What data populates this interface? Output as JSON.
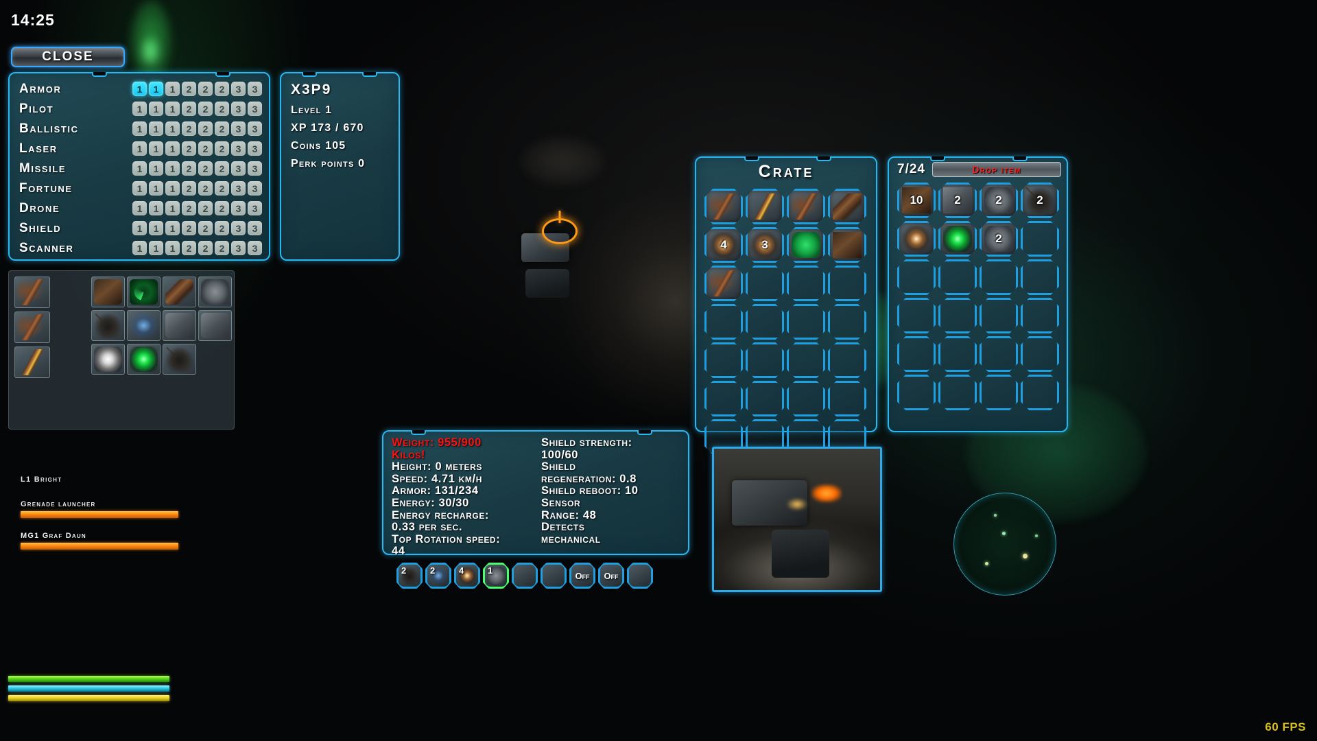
{
  "hud": {
    "clock": "14:25",
    "fps": "60 FPS",
    "close_label": "Close"
  },
  "perks": {
    "rows": [
      {
        "label": "Armor",
        "cells": [
          "1",
          "1",
          "1",
          "2",
          "2",
          "2",
          "3",
          "3"
        ],
        "unlocked": 2
      },
      {
        "label": "Pilot",
        "cells": [
          "1",
          "1",
          "1",
          "2",
          "2",
          "2",
          "3",
          "3"
        ],
        "unlocked": 0
      },
      {
        "label": "Ballistic",
        "cells": [
          "1",
          "1",
          "1",
          "2",
          "2",
          "2",
          "3",
          "3"
        ],
        "unlocked": 0
      },
      {
        "label": "Laser",
        "cells": [
          "1",
          "1",
          "1",
          "2",
          "2",
          "2",
          "3",
          "3"
        ],
        "unlocked": 0
      },
      {
        "label": "Missile",
        "cells": [
          "1",
          "1",
          "1",
          "2",
          "2",
          "2",
          "3",
          "3"
        ],
        "unlocked": 0
      },
      {
        "label": "Fortune",
        "cells": [
          "1",
          "1",
          "1",
          "2",
          "2",
          "2",
          "3",
          "3"
        ],
        "unlocked": 0
      },
      {
        "label": "Drone",
        "cells": [
          "1",
          "1",
          "1",
          "2",
          "2",
          "2",
          "3",
          "3"
        ],
        "unlocked": 0
      },
      {
        "label": "Shield",
        "cells": [
          "1",
          "1",
          "1",
          "2",
          "2",
          "2",
          "3",
          "3"
        ],
        "unlocked": 0
      },
      {
        "label": "Scanner",
        "cells": [
          "1",
          "1",
          "1",
          "2",
          "2",
          "2",
          "3",
          "3"
        ],
        "unlocked": 0
      }
    ]
  },
  "player": {
    "name": "X3P9",
    "level": "Level 1",
    "xp": "XP 173 / 670",
    "coins": "Coins 105",
    "perk_points": "Perk points 0"
  },
  "crate": {
    "title": "Crate",
    "slots": [
      {
        "icon": "minigun-icon",
        "art": "art-gun",
        "count": ""
      },
      {
        "icon": "rifle-icon",
        "art": "art-gun2",
        "count": ""
      },
      {
        "icon": "cannon-icon",
        "art": "art-gun",
        "count": ""
      },
      {
        "icon": "armor-plate-icon",
        "art": "art-pack",
        "count": ""
      },
      {
        "icon": "explosive-icon",
        "art": "art-spark",
        "count": "4"
      },
      {
        "icon": "explosive-icon",
        "art": "art-spark",
        "count": "3"
      },
      {
        "icon": "green-module-icon",
        "art": "art-green-card",
        "count": ""
      },
      {
        "icon": "crate-box-icon",
        "art": "art-dark-brown",
        "count": ""
      },
      {
        "icon": "minigun-icon",
        "art": "art-gun",
        "count": ""
      },
      {
        "icon": "empty-slot-icon",
        "art": "",
        "count": ""
      },
      {
        "icon": "empty-slot-icon",
        "art": "",
        "count": ""
      },
      {
        "icon": "empty-slot-icon",
        "art": "",
        "count": ""
      },
      {
        "icon": "empty-slot-icon",
        "art": "",
        "count": ""
      },
      {
        "icon": "empty-slot-icon",
        "art": "",
        "count": ""
      },
      {
        "icon": "empty-slot-icon",
        "art": "",
        "count": ""
      },
      {
        "icon": "empty-slot-icon",
        "art": "",
        "count": ""
      },
      {
        "icon": "empty-slot-icon",
        "art": "",
        "count": ""
      },
      {
        "icon": "empty-slot-icon",
        "art": "",
        "count": ""
      },
      {
        "icon": "empty-slot-icon",
        "art": "",
        "count": ""
      },
      {
        "icon": "empty-slot-icon",
        "art": "",
        "count": ""
      },
      {
        "icon": "empty-slot-icon",
        "art": "",
        "count": ""
      },
      {
        "icon": "empty-slot-icon",
        "art": "",
        "count": ""
      },
      {
        "icon": "empty-slot-icon",
        "art": "",
        "count": ""
      },
      {
        "icon": "empty-slot-icon",
        "art": "",
        "count": ""
      },
      {
        "icon": "empty-slot-icon",
        "art": "",
        "count": ""
      },
      {
        "icon": "empty-slot-icon",
        "art": "",
        "count": ""
      },
      {
        "icon": "empty-slot-icon",
        "art": "",
        "count": ""
      },
      {
        "icon": "empty-slot-icon",
        "art": "",
        "count": ""
      }
    ]
  },
  "inventory": {
    "count_label": "7/24",
    "drop_label": "Drop item",
    "slots": [
      {
        "icon": "ammo-box-icon",
        "art": "art-dark-brown",
        "count": "10"
      },
      {
        "icon": "battery-icon",
        "art": "art-grey-metal",
        "count": "2"
      },
      {
        "icon": "gear-icon",
        "art": "art-gear",
        "count": "2"
      },
      {
        "icon": "shield-icon",
        "art": "art-bug",
        "count": "2"
      },
      {
        "icon": "explosive-icon",
        "art": "art-spark",
        "count": ""
      },
      {
        "icon": "green-orb-icon",
        "art": "art-green-orb",
        "count": ""
      },
      {
        "icon": "gear-icon",
        "art": "art-gear",
        "count": "2"
      },
      {
        "icon": "empty-slot-icon",
        "art": "",
        "count": ""
      },
      {
        "icon": "empty-slot-icon",
        "art": "",
        "count": ""
      },
      {
        "icon": "empty-slot-icon",
        "art": "",
        "count": ""
      },
      {
        "icon": "empty-slot-icon",
        "art": "",
        "count": ""
      },
      {
        "icon": "empty-slot-icon",
        "art": "",
        "count": ""
      },
      {
        "icon": "empty-slot-icon",
        "art": "",
        "count": ""
      },
      {
        "icon": "empty-slot-icon",
        "art": "",
        "count": ""
      },
      {
        "icon": "empty-slot-icon",
        "art": "",
        "count": ""
      },
      {
        "icon": "empty-slot-icon",
        "art": "",
        "count": ""
      },
      {
        "icon": "empty-slot-icon",
        "art": "",
        "count": ""
      },
      {
        "icon": "empty-slot-icon",
        "art": "",
        "count": ""
      },
      {
        "icon": "empty-slot-icon",
        "art": "",
        "count": ""
      },
      {
        "icon": "empty-slot-icon",
        "art": "",
        "count": ""
      },
      {
        "icon": "empty-slot-icon",
        "art": "",
        "count": ""
      },
      {
        "icon": "empty-slot-icon",
        "art": "",
        "count": ""
      },
      {
        "icon": "empty-slot-icon",
        "art": "",
        "count": ""
      },
      {
        "icon": "empty-slot-icon",
        "art": "",
        "count": ""
      }
    ]
  },
  "equipment": {
    "left_slots": [
      {
        "icon": "minigun-icon",
        "art": "art-gun"
      },
      {
        "icon": "barrel-icon",
        "art": "art-gun"
      },
      {
        "icon": "rifle-icon",
        "art": "art-gun2"
      }
    ],
    "grid_slots": [
      {
        "icon": "engine-icon",
        "art": "art-dark-brown"
      },
      {
        "icon": "radar-icon",
        "art": "art-radar"
      },
      {
        "icon": "armor-plate-icon",
        "art": "art-pack"
      },
      {
        "icon": "gear-icon",
        "art": "art-gear"
      },
      {
        "icon": "thruster-icon",
        "art": "art-bug"
      },
      {
        "icon": "energy-icon",
        "art": "art-blue-bolt"
      },
      {
        "icon": "metal-part-icon",
        "art": "art-grey-metal"
      },
      {
        "icon": "module-icon",
        "art": "art-grey-metal"
      },
      {
        "icon": "white-orb-icon",
        "art": "art-white-orb"
      },
      {
        "icon": "green-orb-icon",
        "art": "art-green-orb"
      },
      {
        "icon": "drone-icon",
        "art": "art-bug"
      }
    ]
  },
  "stats": {
    "left": [
      {
        "text": "Weight: 955/900",
        "warn": true
      },
      {
        "text": "Kilos!",
        "warn": true
      },
      {
        "text": "Height: 0 meters",
        "warn": false
      },
      {
        "text": "Speed: 4.71 km/h",
        "warn": false
      },
      {
        "text": "Armor: 131/234",
        "warn": false
      },
      {
        "text": "Energy: 30/30",
        "warn": false
      },
      {
        "text": "Energy recharge:",
        "warn": false
      },
      {
        "text": "0.33 per sec.",
        "warn": false
      },
      {
        "text": "Top Rotation speed:",
        "warn": false
      },
      {
        "text": "44",
        "warn": false
      }
    ],
    "right": [
      {
        "text": "Shield strength:",
        "warn": false
      },
      {
        "text": "100/60",
        "warn": false
      },
      {
        "text": "Shield",
        "warn": false
      },
      {
        "text": "regeneration: 0.8",
        "warn": false
      },
      {
        "text": "Shield reboot: 10",
        "warn": false
      },
      {
        "text": "Sensor",
        "warn": false
      },
      {
        "text": "Range: 48",
        "warn": false
      },
      {
        "text": "Detects",
        "warn": false
      },
      {
        "text": "mechanical",
        "warn": false
      }
    ]
  },
  "hotbar": [
    {
      "num": "2",
      "icon": "shield-icon",
      "art": "art-bug",
      "active": false,
      "off": ""
    },
    {
      "num": "2",
      "icon": "energy-icon",
      "art": "art-blue-bolt",
      "active": false,
      "off": ""
    },
    {
      "num": "4",
      "icon": "explosive-icon",
      "art": "art-spark",
      "active": false,
      "off": ""
    },
    {
      "num": "1",
      "icon": "gear-icon",
      "art": "art-gear",
      "active": true,
      "off": ""
    },
    {
      "num": "",
      "icon": "empty-slot-icon",
      "art": "",
      "active": false,
      "off": ""
    },
    {
      "num": "",
      "icon": "empty-slot-icon",
      "art": "",
      "active": false,
      "off": ""
    },
    {
      "num": "",
      "icon": "toggle-icon",
      "art": "",
      "active": false,
      "off": "Off"
    },
    {
      "num": "",
      "icon": "toggle-icon",
      "art": "",
      "active": false,
      "off": "Off"
    },
    {
      "num": "",
      "icon": "empty-slot-icon",
      "art": "",
      "active": false,
      "off": ""
    }
  ],
  "weapon_status": {
    "header": "L1 Bright",
    "weapons": [
      {
        "name": "Grenade launcher",
        "bar": "bar-orange"
      },
      {
        "name": "MG1 Graf Daun",
        "bar": "bar-orange"
      }
    ],
    "bottom_bars": [
      "bar-green",
      "bar-cyan",
      "bar-yellow"
    ]
  }
}
